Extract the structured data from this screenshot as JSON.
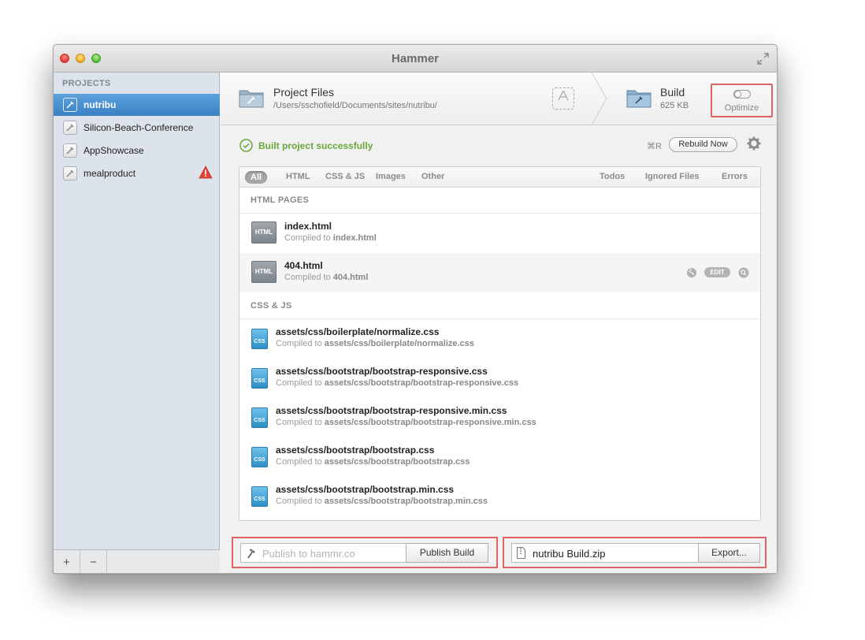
{
  "window": {
    "title": "Hammer"
  },
  "sidebar": {
    "header": "PROJECTS",
    "projects": [
      {
        "name": "nutribu",
        "selected": true
      },
      {
        "name": "Silicon-Beach-Conference"
      },
      {
        "name": "AppShowcase"
      },
      {
        "name": "mealproduct",
        "warning": true
      }
    ],
    "footer": {
      "add_label": "+",
      "remove_label": "−"
    }
  },
  "pathbar": {
    "project_files_title": "Project Files",
    "project_path": "/Users/sschofield/Documents/sites/nutribu/",
    "build_title": "Build",
    "build_size": "625 KB",
    "optimize_label": "Optimize"
  },
  "status": {
    "message": "Built project successfully",
    "shortcut": "⌘R",
    "rebuild_label": "Rebuild Now"
  },
  "filters": {
    "left": [
      "All",
      "HTML",
      "CSS & JS",
      "Images",
      "Other"
    ],
    "right": [
      "Todos",
      "Ignored Files",
      "Errors"
    ],
    "active": "All"
  },
  "sections": {
    "html_pages": {
      "title": "HTML PAGES",
      "files": [
        {
          "name": "index.html",
          "compiled_prefix": "Compiled to",
          "compiled_target": "index.html",
          "icon_label": "HTML"
        },
        {
          "name": "404.html",
          "compiled_prefix": "Compiled to",
          "compiled_target": "404.html",
          "icon_label": "HTML",
          "edit_label": "EDIT"
        }
      ]
    },
    "css_js": {
      "title": "CSS & JS",
      "files": [
        {
          "name": "assets/css/boilerplate/normalize.css",
          "compiled_prefix": "Compiled to",
          "compiled_target": "assets/css/boilerplate/normalize.css",
          "icon_label": "CSS"
        },
        {
          "name": "assets/css/bootstrap/bootstrap-responsive.css",
          "compiled_prefix": "Compiled to",
          "compiled_target": "assets/css/bootstrap/bootstrap-responsive.css",
          "icon_label": "CSS"
        },
        {
          "name": "assets/css/bootstrap/bootstrap-responsive.min.css",
          "compiled_prefix": "Compiled to",
          "compiled_target": "assets/css/bootstrap/bootstrap-responsive.min.css",
          "icon_label": "CSS"
        },
        {
          "name": "assets/css/bootstrap/bootstrap.css",
          "compiled_prefix": "Compiled to",
          "compiled_target": "assets/css/bootstrap/bootstrap.css",
          "icon_label": "CSS"
        },
        {
          "name": "assets/css/bootstrap/bootstrap.min.css",
          "compiled_prefix": "Compiled to",
          "compiled_target": "assets/css/bootstrap/bootstrap.min.css",
          "icon_label": "CSS"
        }
      ]
    }
  },
  "bottom": {
    "publish_placeholder": "Publish to hammr.co",
    "publish_button": "Publish Build",
    "export_filename": "nutribu Build.zip",
    "export_button": "Export..."
  },
  "colors": {
    "accent_selection": "#3b7fc4",
    "success": "#6aa839",
    "highlight_box": "#e06363",
    "warning": "#e0453a"
  },
  "icons": {
    "project": "hammer-icon",
    "folder": "folder-icon",
    "status": "check-circle-icon",
    "settings": "gear-icon",
    "warning": "warning-triangle-icon"
  }
}
